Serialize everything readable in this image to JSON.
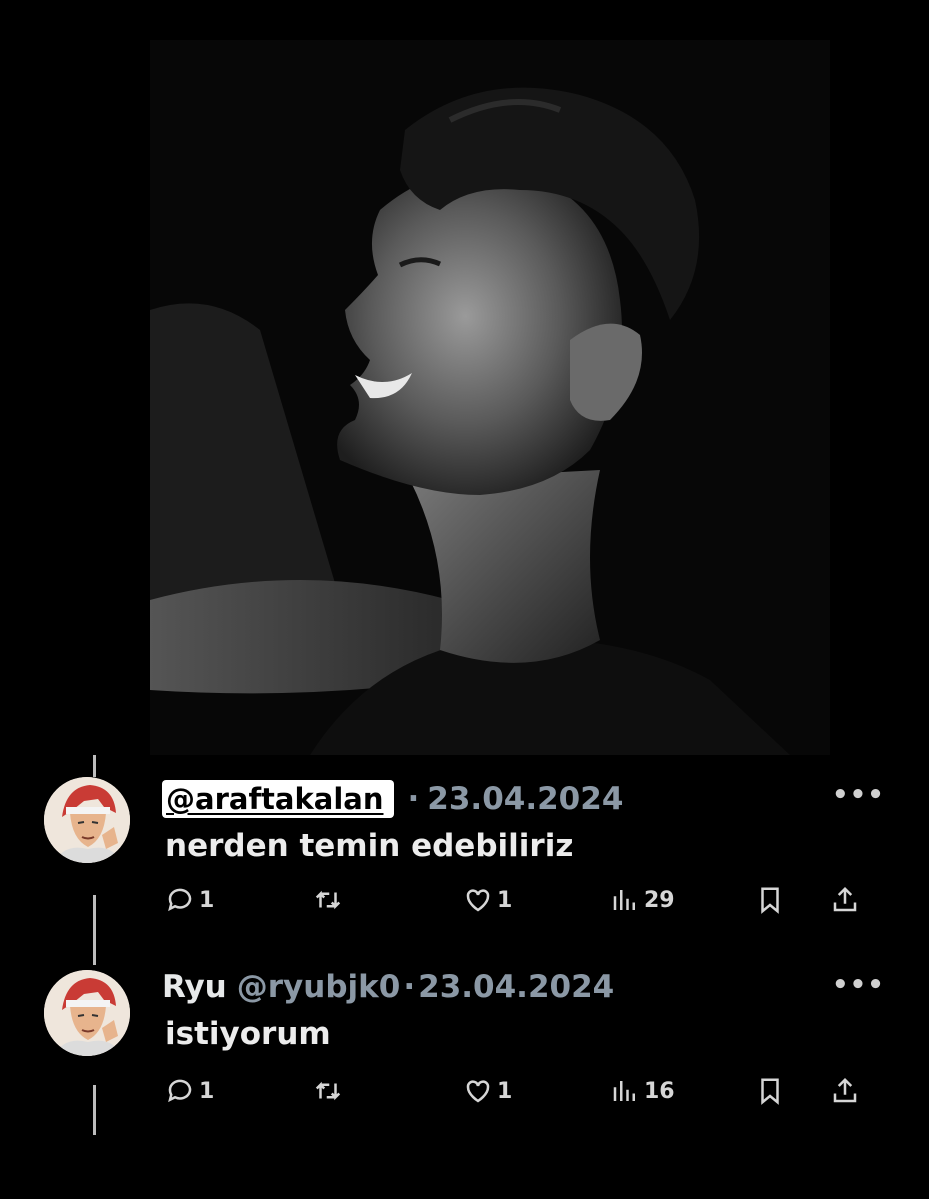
{
  "tweets": [
    {
      "name": "",
      "handle": "@araftakalan",
      "separator": "·",
      "date": "23.04.2024",
      "text": "nerden temin edebiliriz",
      "replies": "1",
      "retweets": "",
      "likes": "1",
      "views": "29"
    },
    {
      "name": "Ryu",
      "handle": "@ryubjk0",
      "separator": "·",
      "date": "23.04.2024",
      "text": "istiyorum",
      "replies": "1",
      "retweets": "",
      "likes": "1",
      "views": "16"
    }
  ],
  "menu_icon": "more-horizontal-icon",
  "colors": {
    "background": "#000000",
    "text": "#e7e9ea",
    "muted": "#8b98a5",
    "handle_highlight": "#ffffff"
  }
}
